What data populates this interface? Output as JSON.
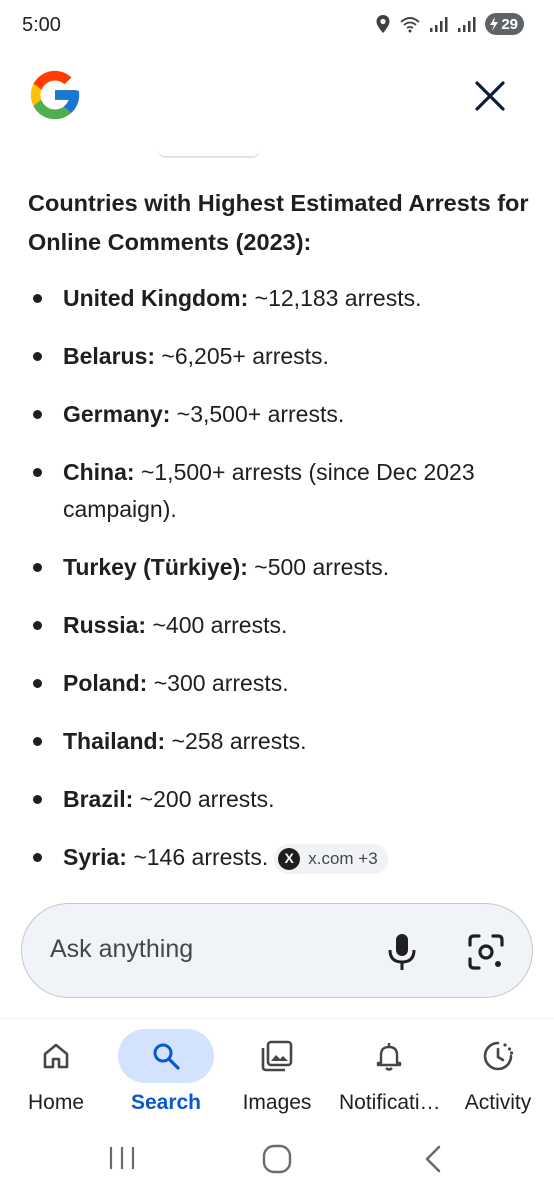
{
  "status_bar": {
    "time": "5:00",
    "battery": "29",
    "icons": [
      "location-icon",
      "wifi-icon",
      "signal-icon",
      "signal-icon",
      "battery-icon"
    ]
  },
  "header": {
    "logo": "google-g-logo",
    "close_icon": "close-icon"
  },
  "answer": {
    "heading": "Countries with Highest Estimated Arrests for Online Comments (2023):",
    "items": [
      {
        "country": "United Kingdom:",
        "text": " ~12,183 arrests."
      },
      {
        "country": "Belarus:",
        "text": " ~6,205+ arrests."
      },
      {
        "country": "Germany:",
        "text": " ~3,500+ arrests."
      },
      {
        "country": "China:",
        "text": " ~1,500+ arrests (since Dec 2023 campaign)."
      },
      {
        "country": "Turkey (Türkiye):",
        "text": " ~500 arrests."
      },
      {
        "country": "Russia:",
        "text": " ~400 arrests."
      },
      {
        "country": "Poland:",
        "text": " ~300 arrests."
      },
      {
        "country": "Thailand:",
        "text": " ~258 arrests."
      },
      {
        "country": "Brazil:",
        "text": " ~200 arrests."
      },
      {
        "country": "Syria:",
        "text": " ~146 arrests."
      }
    ],
    "source_chip": {
      "logo": "X",
      "label": "x.com +3"
    }
  },
  "ask_bar": {
    "placeholder": "Ask anything",
    "icons": [
      "microphone-icon",
      "lens-icon"
    ]
  },
  "bottom_nav": {
    "items": [
      {
        "label": "Home",
        "icon": "home-icon",
        "active": false
      },
      {
        "label": "Search",
        "icon": "search-icon",
        "active": true
      },
      {
        "label": "Images",
        "icon": "images-icon",
        "active": false
      },
      {
        "label": "Notificati…",
        "icon": "bell-icon",
        "active": false
      },
      {
        "label": "Activity",
        "icon": "activity-icon",
        "active": false
      }
    ]
  },
  "colors": {
    "accent": "#0b57d0",
    "active_pill": "#d3e3fd",
    "text": "#1f1f1f",
    "ask_bar_bg": "#f0f4f9"
  }
}
